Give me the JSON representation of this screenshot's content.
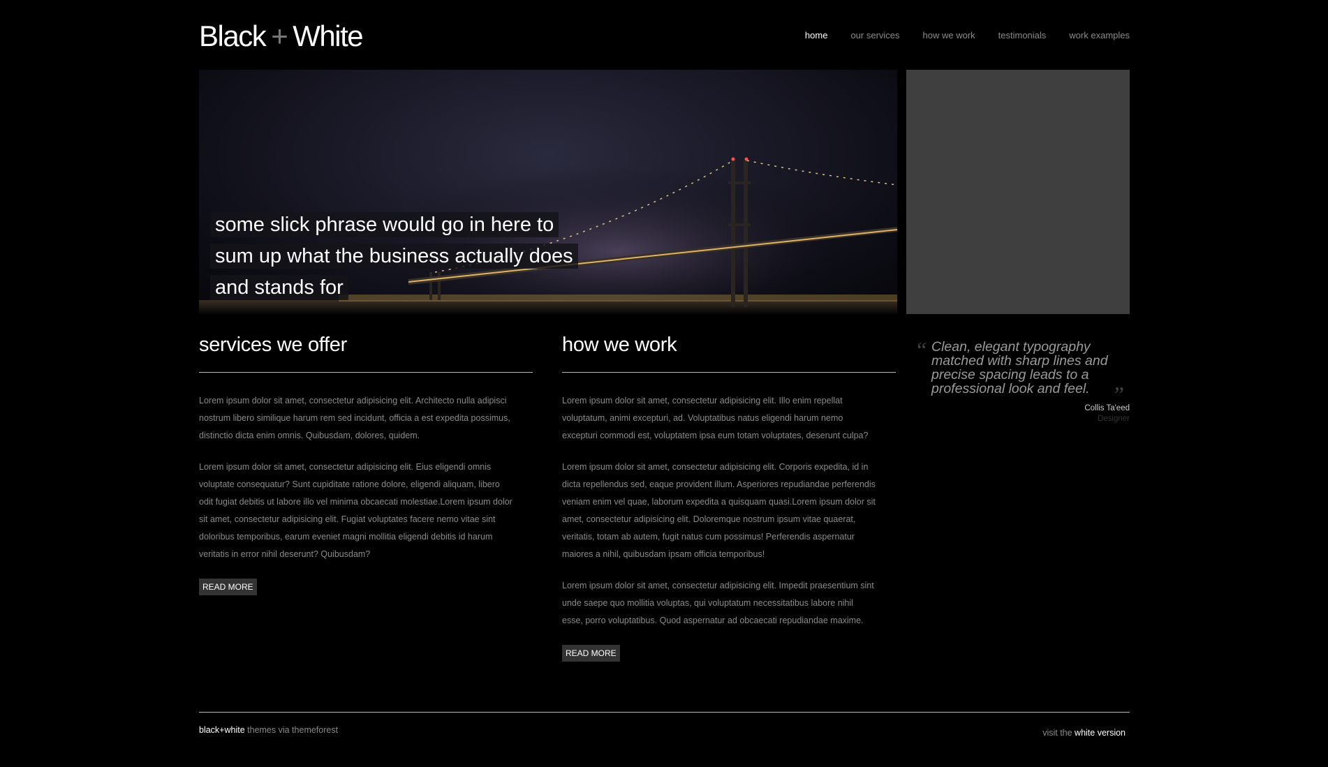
{
  "header": {
    "logo_black": "Black",
    "logo_plus": "+",
    "logo_white": "White"
  },
  "nav": {
    "items": [
      {
        "label": "home",
        "active": true
      },
      {
        "label": "our services"
      },
      {
        "label": "how we work"
      },
      {
        "label": "testimonials"
      },
      {
        "label": "work examples"
      }
    ]
  },
  "hero": {
    "phrase": "some slick phrase would go in here to sum up what the business actually does and stands for"
  },
  "services": {
    "title": "services we offer",
    "paragraphs": [
      "Lorem ipsum dolor sit amet, consectetur adipisicing elit. Architecto nulla adipisci nostrum libero similique harum rem sed incidunt, officia a est expedita possimus, distinctio dicta enim omnis. Quibusdam, dolores, quidem.",
      "Lorem ipsum dolor sit amet, consectetur adipisicing elit. Eius eligendi omnis voluptate consequatur? Sunt cupiditate ratione dolore, eligendi aliquam, libero odit fugiat debitis ut labore illo vel minima obcaecati molestiae.Lorem ipsum dolor sit amet, consectetur adipisicing elit. Fugiat voluptates facere nemo vitae sint doloribus temporibus, earum eveniet magni mollitia eligendi debitis id harum veritatis in error nihil deserunt? Quibusdam?"
    ],
    "button": "READ MORE"
  },
  "howwework": {
    "title": "how we work",
    "paragraphs": [
      "Lorem ipsum dolor sit amet, consectetur adipisicing elit. Illo enim repellat voluptatum, animi excepturi, ad. Voluptatibus natus eligendi harum nemo excepturi commodi est, voluptatem ipsa eum totam voluptates, deserunt culpa?",
      "Lorem ipsum dolor sit amet, consectetur adipisicing elit. Corporis expedita, id in dicta repellendus sed, eaque provident illum. Asperiores repudiandae perferendis veniam enim vel quae, laborum expedita a quisquam quasi.Lorem ipsum dolor sit amet, consectetur adipisicing elit. Doloremque nostrum ipsum vitae quaerat, veritatis, totam ab autem, fugit natus cum possimus! Perferendis aspernatur maiores a nihil, quibusdam ipsam officia temporibus!",
      "Lorem ipsum dolor sit amet, consectetur adipisicing elit. Impedit praesentium sint unde saepe quo mollitia voluptas, qui voluptatum necessitatibus labore nihil esse, porro voluptatibus. Quod aspernatur ad obcaecati repudiandae maxime."
    ],
    "button": "READ MORE"
  },
  "quote": {
    "open": "“",
    "close": "”",
    "text": "Clean, elegant typography matched with sharp lines and precise spacing leads to a professional look and feel.",
    "author": "Collis Ta'eed",
    "role": "Designer"
  },
  "footer": {
    "brand": "black+white",
    "tagline": " themes via themeforest",
    "visit_prefix": "visit the ",
    "visit_link": "white version"
  },
  "colors": {
    "background": "#000000",
    "text": "#8a8a8a",
    "side_box": "#3f3f3f",
    "button_bg": "#333333"
  }
}
